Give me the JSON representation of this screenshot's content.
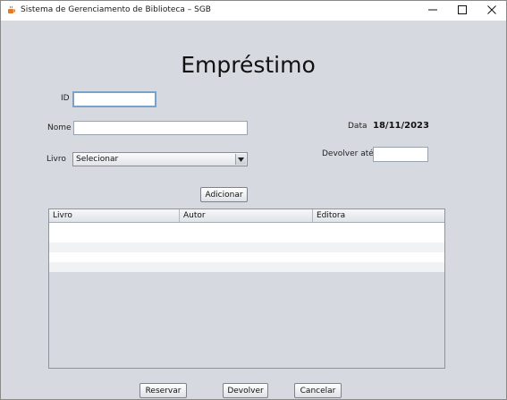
{
  "window": {
    "title": "Sistema de Gerenciamento de Biblioteca – SGB"
  },
  "form": {
    "heading": "Empréstimo",
    "id_label": "ID",
    "id_value": "",
    "nome_label": "Nome",
    "nome_value": "",
    "livro_label": "Livro",
    "livro_selected": "Selecionar",
    "data_label": "Data",
    "data_value": "18/11/2023",
    "devolver_ate_label": "Devolver até",
    "devolver_ate_value": "",
    "add_button": "Adicionar"
  },
  "table": {
    "columns": [
      "Livro",
      "Autor",
      "Editora"
    ],
    "rows": []
  },
  "actions": {
    "reservar": "Reservar",
    "devolver": "Devolver",
    "cancelar": "Cancelar"
  },
  "icons": {
    "app": "java-cup-icon",
    "minimize": "minimize-icon",
    "maximize": "maximize-icon",
    "close": "close-icon",
    "dropdown": "chevron-down-icon"
  }
}
